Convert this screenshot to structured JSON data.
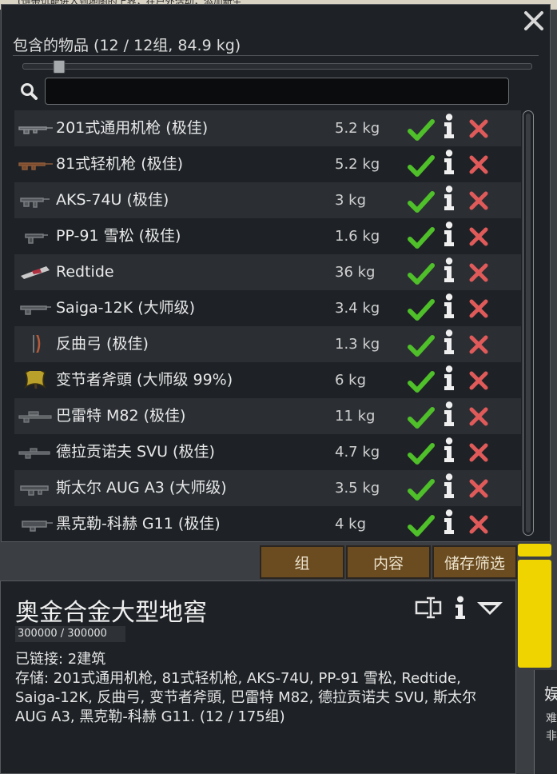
{
  "background": {
    "top_text": "(饱带饥能进入到地图的上界，在户外活动，添加新生",
    "right_panel_line1": "娱",
    "right_panel_line2": "难",
    "right_panel_line3": "非"
  },
  "panel": {
    "title": "包含的物品 (12 / 12组, 84.9 kg)",
    "close_icon": "close-icon",
    "slider_value_fraction": 0.07,
    "search": {
      "value": "",
      "placeholder": "",
      "icon": "search-icon"
    },
    "items": [
      {
        "name": "201式通用机枪 (极佳)",
        "mass": "5.2 kg",
        "thumb": "machine-gun-icon"
      },
      {
        "name": "81式轻机枪 (极佳)",
        "mass": "5.2 kg",
        "thumb": "light-machine-gun-icon"
      },
      {
        "name": "AKS-74U (极佳)",
        "mass": "3 kg",
        "thumb": "rifle-icon"
      },
      {
        "name": "PP-91 雪松 (极佳)",
        "mass": "1.6 kg",
        "thumb": "smg-icon"
      },
      {
        "name": "Redtide",
        "mass": "36 kg",
        "thumb": "heavy-weapon-icon"
      },
      {
        "name": "Saiga-12K (大师级)",
        "mass": "3.4 kg",
        "thumb": "shotgun-icon"
      },
      {
        "name": "反曲弓 (极佳)",
        "mass": "1.3 kg",
        "thumb": "bow-icon"
      },
      {
        "name": "变节者斧頭 (大师级 99%)",
        "mass": "6 kg",
        "thumb": "axe-icon"
      },
      {
        "name": "巴雷特 M82 (极佳)",
        "mass": "11 kg",
        "thumb": "sniper-rifle-icon"
      },
      {
        "name": "德拉贡诺夫 SVU (极佳)",
        "mass": "4.7 kg",
        "thumb": "marksman-rifle-icon"
      },
      {
        "name": "斯太尔 AUG A3 (大师级)",
        "mass": "3.5 kg",
        "thumb": "bullpup-rifle-icon"
      },
      {
        "name": "黑克勒-科赫 G11 (极佳)",
        "mass": "4 kg",
        "thumb": "caseless-rifle-icon"
      }
    ],
    "row_icons": {
      "allow": "checkmark-icon",
      "info": "info-icon",
      "drop": "x-icon"
    }
  },
  "tabs": [
    {
      "label": "组"
    },
    {
      "label": "内容"
    },
    {
      "label": "储存筛选"
    }
  ],
  "inspect": {
    "title": "奥金合金大型地窖",
    "hp": "300000 / 300000",
    "linked": "已链接: 2建筑",
    "storage": "存储: 201式通用机枪, 81式轻机枪, AKS-74U, PP-91 雪松, Redtide, Saiga-12K, 反曲弓, 变节者斧頭, 巴雷特 M82, 德拉贡诺夫 SVU, 斯太尔 AUG A3, 黑克勒-科赫 G11. (12 / 175组)",
    "icons": [
      "rename-icon",
      "info-icon",
      "collapse-icon"
    ]
  },
  "colors": {
    "panel_bg": "#1e2226",
    "row_alt": "#2b2f34",
    "check_green": "#4fbf2a",
    "delete_red": "#e05a5a",
    "tab_brown": "#6b4c21",
    "accent_yellow": "#f0d400"
  }
}
